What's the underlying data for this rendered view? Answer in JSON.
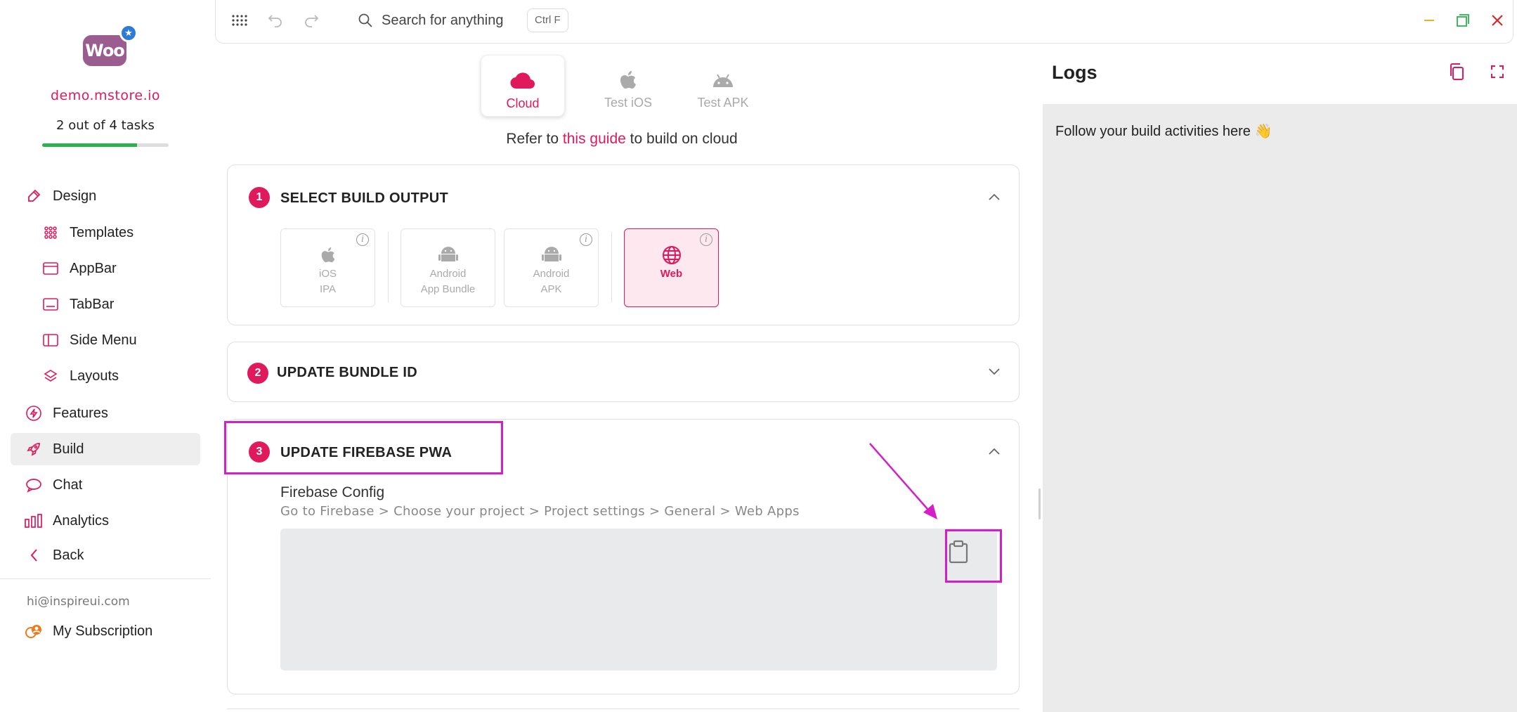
{
  "sidebar": {
    "store_name": "demo.mstore.io",
    "logo_text": "Woo",
    "task_progress_text": "2 out of 4 tasks",
    "task_progress_fraction": 0.75,
    "items": [
      {
        "label": "Design",
        "icon": "brush-icon"
      },
      {
        "label": "Templates",
        "icon": "grid-dots-icon"
      },
      {
        "label": "AppBar",
        "icon": "appbar-icon"
      },
      {
        "label": "TabBar",
        "icon": "tabbar-icon"
      },
      {
        "label": "Side Menu",
        "icon": "side-menu-icon"
      },
      {
        "label": "Layouts",
        "icon": "layers-icon"
      },
      {
        "label": "Features",
        "icon": "bolt-icon"
      },
      {
        "label": "Build",
        "icon": "rocket-icon"
      },
      {
        "label": "Chat",
        "icon": "chat-icon"
      },
      {
        "label": "Analytics",
        "icon": "bar-chart-icon"
      },
      {
        "label": "Back",
        "icon": "chevron-left-icon"
      }
    ],
    "active_item": "Build",
    "email": "hi@inspireui.com",
    "subscription_label": "My Subscription"
  },
  "topbar": {
    "search_placeholder": "Search for anything",
    "shortcut": "Ctrl F"
  },
  "build_tabs": [
    {
      "label": "Cloud",
      "icon": "cloud-icon",
      "active": true
    },
    {
      "label": "Test iOS",
      "icon": "apple-icon",
      "active": false
    },
    {
      "label": "Test APK",
      "icon": "android-icon",
      "active": false
    }
  ],
  "guide": {
    "prefix": "Refer to",
    "link": "this guide",
    "suffix": "to build on cloud"
  },
  "sections": {
    "output": {
      "number": "1",
      "title": "SELECT BUILD OUTPUT",
      "options": [
        {
          "line1": "iOS",
          "line2": "IPA",
          "icon": "apple-icon",
          "selected": false
        },
        {
          "line1": "Android",
          "line2": "App Bundle",
          "icon": "android-icon",
          "selected": false
        },
        {
          "line1": "Android",
          "line2": "APK",
          "icon": "android-icon",
          "selected": false
        },
        {
          "line1": "Web",
          "line2": "",
          "icon": "globe-icon",
          "selected": true
        }
      ]
    },
    "bundle": {
      "number": "2",
      "title": "UPDATE BUNDLE ID"
    },
    "firebase": {
      "number": "3",
      "title": "UPDATE FIREBASE PWA",
      "config_label": "Firebase Config",
      "config_help": "Go to Firebase > Choose your project > Project settings > General > Web Apps"
    }
  },
  "logs": {
    "title": "Logs",
    "message": "Follow your build activities here 👋"
  },
  "colors": {
    "accent": "#e0185c",
    "progress": "#2bb24c",
    "highlight": "#d41fc9"
  }
}
